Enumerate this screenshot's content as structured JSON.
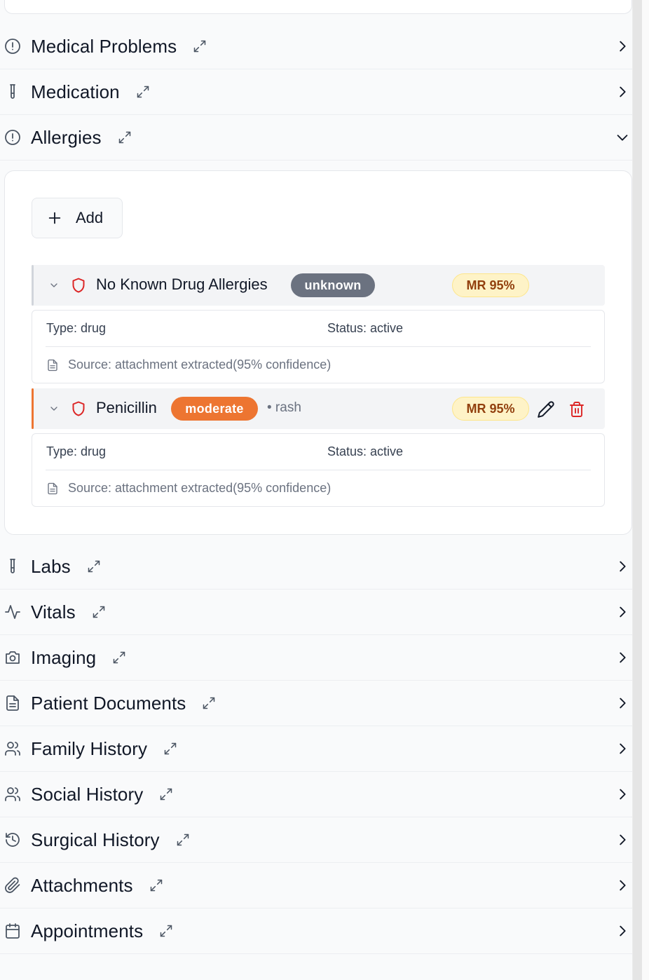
{
  "sections_top": [
    {
      "label": "Medical Problems",
      "icon": "alert-circle-icon"
    },
    {
      "label": "Medication",
      "icon": "test-tube-icon"
    },
    {
      "label": "Allergies",
      "icon": "alert-circle-icon"
    }
  ],
  "allergies": {
    "add_label": "Add",
    "items": [
      {
        "name": "No Known Drug Allergies",
        "severity": "unknown",
        "severity_color": "#6b7280",
        "reaction": "",
        "mr_badge": "MR 95%",
        "type": "Type: drug",
        "status": "Status: active",
        "source": "Source: attachment extracted(95% confidence)"
      },
      {
        "name": "Penicillin",
        "severity": "moderate",
        "severity_color": "#ed7531",
        "reaction": "• rash",
        "mr_badge": "MR 95%",
        "type": "Type: drug",
        "status": "Status: active",
        "source": "Source: attachment extracted(95% confidence)"
      }
    ]
  },
  "sections_bottom": [
    {
      "label": "Labs",
      "icon": "test-tube-icon"
    },
    {
      "label": "Vitals",
      "icon": "activity-icon"
    },
    {
      "label": "Imaging",
      "icon": "camera-icon"
    },
    {
      "label": "Patient Documents",
      "icon": "file-text-icon"
    },
    {
      "label": "Family History",
      "icon": "users-icon"
    },
    {
      "label": "Social History",
      "icon": "users-icon"
    },
    {
      "label": "Surgical History",
      "icon": "history-icon"
    },
    {
      "label": "Attachments",
      "icon": "paperclip-icon"
    },
    {
      "label": "Appointments",
      "icon": "calendar-icon"
    }
  ],
  "colors": {
    "accent_orange": "#ed7531",
    "danger_red": "#dc2626",
    "badge_bg": "#fef3c7",
    "badge_text": "#92400e"
  }
}
